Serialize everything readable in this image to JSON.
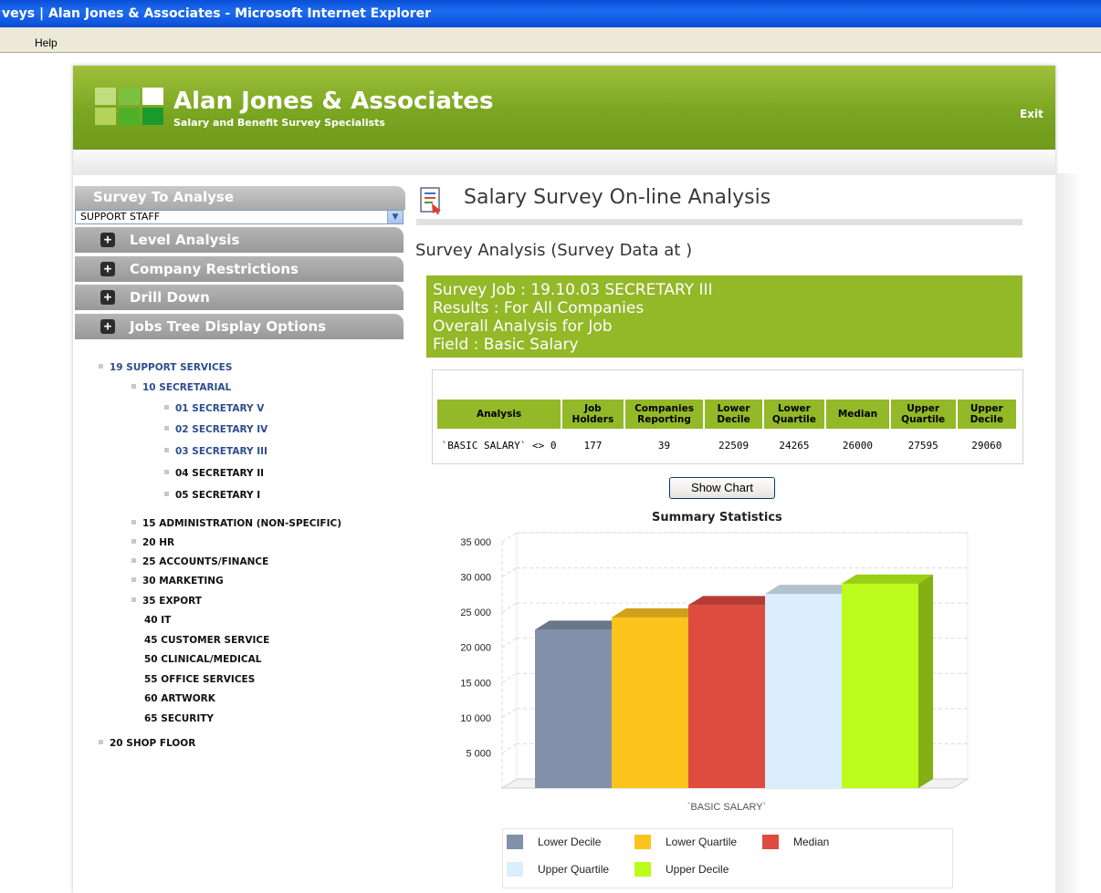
{
  "window": {
    "title": "veys | Alan Jones & Associates - Microsoft Internet Explorer"
  },
  "menu": {
    "items": [
      "Help"
    ]
  },
  "header": {
    "brand": "Alan Jones & Associates",
    "tagline": "Salary and Benefit Survey Specialists",
    "exit_label": "Exit",
    "logo_colors": [
      "#c2dd80",
      "#7cc142",
      "#ffffff",
      "#b5d35a",
      "#4fb12a",
      "#1a9a2c"
    ]
  },
  "sidebar": {
    "survey_title": "Survey To Analyse",
    "survey_value": "SUPPORT STAFF",
    "sections": [
      "Level Analysis",
      "Company Restrictions",
      "Drill Down",
      "Jobs Tree Display Options"
    ],
    "tree": [
      {
        "label": "19 SUPPORT SERVICES",
        "color": "blue",
        "bullet": true
      },
      {
        "label": "10 SECRETARIAL",
        "color": "blue",
        "bullet": true
      },
      {
        "label": "01 SECRETARY V",
        "color": "blue",
        "bullet": true
      },
      {
        "label": "02 SECRETARY IV",
        "color": "blue",
        "bullet": true
      },
      {
        "label": "03 SECRETARY III",
        "color": "blue",
        "bullet": true
      },
      {
        "label": "04 SECRETARY II",
        "color": "blk",
        "bullet": true
      },
      {
        "label": "05 SECRETARY I",
        "color": "blk",
        "bullet": true
      },
      {
        "label": "15 ADMINISTRATION (NON-SPECIFIC)",
        "color": "blk",
        "bullet": true
      },
      {
        "label": "20 HR",
        "color": "blk",
        "bullet": true
      },
      {
        "label": "25 ACCOUNTS/FINANCE",
        "color": "blk",
        "bullet": true
      },
      {
        "label": "30 MARKETING",
        "color": "blk",
        "bullet": true
      },
      {
        "label": "35 EXPORT",
        "color": "blk",
        "bullet": true
      },
      {
        "label": "40 IT",
        "color": "blk",
        "bullet": false
      },
      {
        "label": "45 CUSTOMER SERVICE",
        "color": "blk",
        "bullet": false
      },
      {
        "label": "50 CLINICAL/MEDICAL",
        "color": "blk",
        "bullet": false
      },
      {
        "label": "55 OFFICE SERVICES",
        "color": "blk",
        "bullet": false
      },
      {
        "label": "60 ARTWORK",
        "color": "blk",
        "bullet": false
      },
      {
        "label": "65 SECURITY",
        "color": "blk",
        "bullet": false
      },
      {
        "label": "20 SHOP FLOOR",
        "color": "blk",
        "bullet": true
      }
    ]
  },
  "main": {
    "page_title": "Salary Survey On-line Analysis",
    "analysis_title": "Survey Analysis (Survey Data at )",
    "info_lines": [
      "Survey Job : 19.10.03 SECRETARY III",
      "Results : For All Companies",
      "Overall Analysis for Job",
      "Field : Basic Salary"
    ],
    "table": {
      "headers": [
        "Analysis",
        "Job Holders",
        "Companies Reporting",
        "Lower Decile",
        "Lower Quartile",
        "Median",
        "Upper Quartile",
        "Upper Decile"
      ],
      "row": [
        "`BASIC SALARY` <> 0",
        "177",
        "39",
        "22509",
        "24265",
        "26000",
        "27595",
        "29060"
      ]
    },
    "show_chart_label": "Show Chart",
    "accent": "#93b828"
  },
  "chart_data": {
    "type": "bar",
    "title": "Summary Statistics",
    "categories": [
      "`BASIC SALARY`"
    ],
    "series": [
      {
        "name": "Lower Decile",
        "values": [
          22509
        ],
        "color": "#8290a9"
      },
      {
        "name": "Lower Quartile",
        "values": [
          24265
        ],
        "color": "#fdc31d"
      },
      {
        "name": "Median",
        "values": [
          26000
        ],
        "color": "#de4b3f"
      },
      {
        "name": "Upper Quartile",
        "values": [
          27595
        ],
        "color": "#daeefb"
      },
      {
        "name": "Upper Decile",
        "values": [
          29060
        ],
        "color": "#bbfc1a"
      }
    ],
    "ylim": [
      0,
      35000
    ],
    "yticks": [
      "35 000",
      "30 000",
      "25 000",
      "20 000",
      "15 000",
      "10 000",
      "5 000"
    ],
    "ytick_values": [
      35000,
      30000,
      25000,
      20000,
      15000,
      10000,
      5000
    ],
    "legend": "bottom",
    "grid": true
  }
}
